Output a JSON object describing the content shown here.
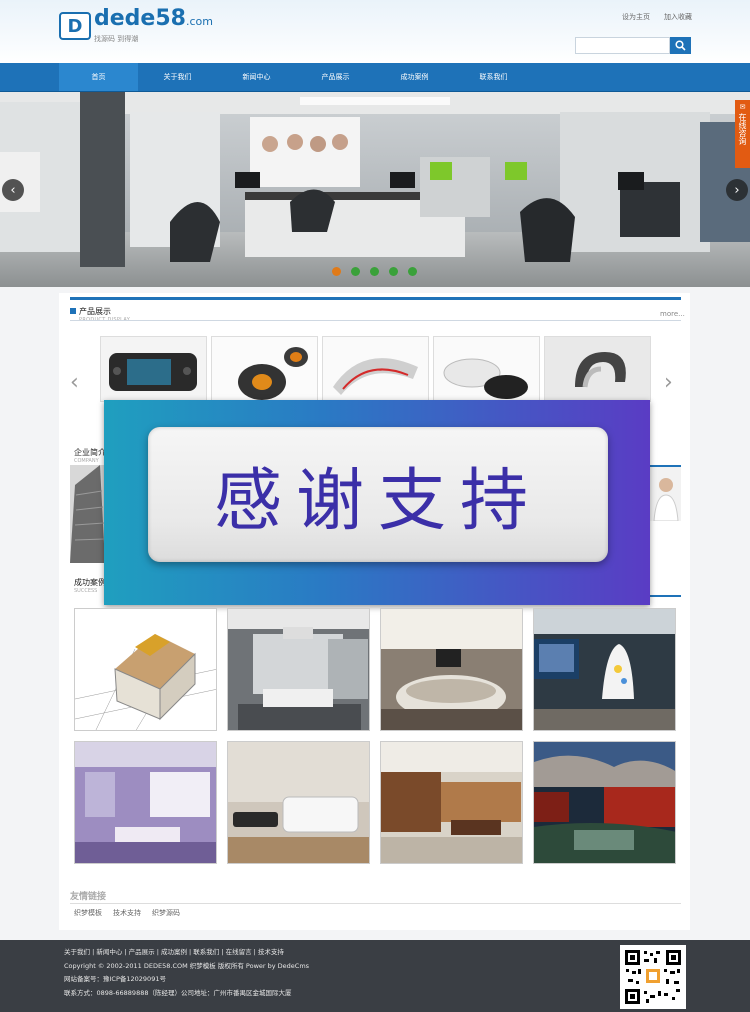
{
  "header": {
    "logo_mark": "D",
    "logo_name": "dede58",
    "logo_domain": ".com",
    "logo_slogan": "找源码 到得潮",
    "top_links": [
      "设为主页",
      "加入收藏"
    ],
    "search_placeholder": ""
  },
  "nav": {
    "items": [
      "首页",
      "关于我们",
      "新闻中心",
      "产品展示",
      "成功案例",
      "联系我们"
    ],
    "active_index": 0
  },
  "banner": {
    "prev_label": "‹",
    "next_label": "›",
    "slide_count": 5,
    "active_slide": 0,
    "consult_label": "在线咨询"
  },
  "products": {
    "title": "产品展示",
    "subtitle": "PRODUCT DISPLAY",
    "more": "more...",
    "prev_label": "‹",
    "next_label": "›"
  },
  "overlay": {
    "text": "感谢支持"
  },
  "about": {
    "title": "企业简介",
    "subtitle": "COMPANY"
  },
  "cases": {
    "title": "成功案例",
    "subtitle": "SUCCESS"
  },
  "friend_links": {
    "title": "友情链接",
    "items": [
      "织梦模板",
      "技术支持",
      "织梦源码"
    ]
  },
  "footer": {
    "nav_line": "关于我们 | 新闻中心 | 产品展示 | 成功案例 | 联系我们 | 在线留言 | 技术支持",
    "copyright": "Copyright © 2002-2011 DEDE58.COM 织梦模板 版权所有 Power by DedeCms",
    "icp": "网站备案号：豫ICP备12029091号",
    "contact": "联系方式：0898-66889888（陈经理）公司地址：广州市番禺区金城国际大厦"
  },
  "colors": {
    "brand_blue": "#1e72b8",
    "footer_bg": "#3a3e44",
    "consult_orange": "#e25b12",
    "slider_dot": "#3aa13a",
    "slider_dot_active": "#e07a18",
    "overlay_text": "#3b2fa8"
  }
}
